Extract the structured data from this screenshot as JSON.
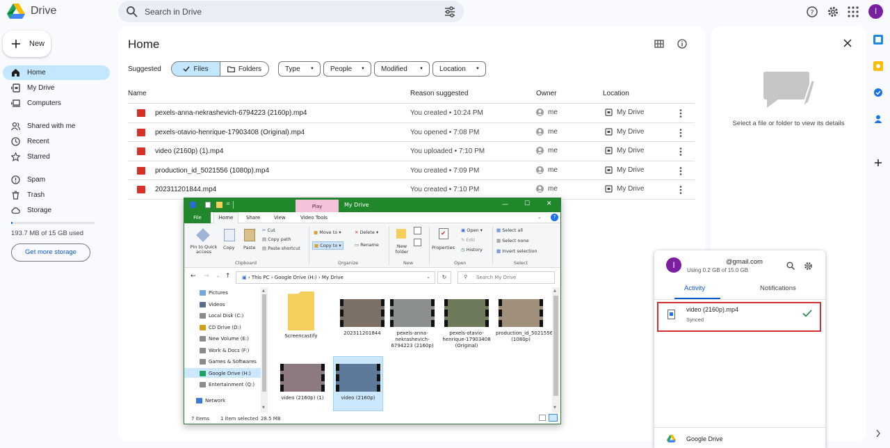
{
  "app": {
    "name": "Drive"
  },
  "search": {
    "placeholder": "Search in Drive"
  },
  "header": {
    "avatar_letter": "I"
  },
  "sidebar": {
    "new_label": "New",
    "items": [
      {
        "label": "Home"
      },
      {
        "label": "My Drive"
      },
      {
        "label": "Computers"
      },
      {
        "label": "Shared with me"
      },
      {
        "label": "Recent"
      },
      {
        "label": "Starred"
      },
      {
        "label": "Spam"
      },
      {
        "label": "Trash"
      },
      {
        "label": "Storage"
      }
    ],
    "storage_text": "193.7 MB of 15 GB used",
    "storage_fraction": 0.013,
    "get_storage_label": "Get more storage"
  },
  "main": {
    "title": "Home",
    "suggested_label": "Suggested",
    "files_chip": "Files",
    "folders_chip": "Folders",
    "filters": [
      "Type",
      "People",
      "Modified",
      "Location"
    ],
    "columns": {
      "name": "Name",
      "reason": "Reason suggested",
      "owner": "Owner",
      "location": "Location"
    },
    "rows": [
      {
        "name": "pexels-anna-nekrashevich-6794223 (2160p).mp4",
        "reason": "You created • 10:24 PM",
        "owner": "me",
        "location": "My Drive"
      },
      {
        "name": "pexels-otavio-henrique-17903408 (Original).mp4",
        "reason": "You opened • 7:08 PM",
        "owner": "me",
        "location": "My Drive"
      },
      {
        "name": "video (2160p) (1).mp4",
        "reason": "You uploaded • 7:10 PM",
        "owner": "me",
        "location": "My Drive"
      },
      {
        "name": "production_id_5021556 (1080p).mp4",
        "reason": "You created • 7:09 PM",
        "owner": "me",
        "location": "My Drive"
      },
      {
        "name": "202311201844.mp4",
        "reason": "You created • 7:10 PM",
        "owner": "me",
        "location": "My Drive"
      }
    ]
  },
  "details_panel": {
    "empty_text": "Select a file or folder to view its details"
  },
  "explorer": {
    "title": "My Drive",
    "play_tab": "Play",
    "video_tools_tab": "Video Tools",
    "tabs": [
      "File",
      "Home",
      "Share",
      "View"
    ],
    "ribbon": {
      "pin": "Pin to Quick access",
      "copy": "Copy",
      "paste": "Paste",
      "cut": "Cut",
      "copy_path": "Copy path",
      "paste_shortcut": "Paste shortcut",
      "move_to": "Move to",
      "copy_to": "Copy to",
      "delete": "Delete",
      "rename": "Rename",
      "new_folder": "New folder",
      "properties": "Properties",
      "open": "Open",
      "edit": "Edit",
      "history": "History",
      "select_all": "Select all",
      "select_none": "Select none",
      "invert": "Invert selection",
      "groups": [
        "Clipboard",
        "Organize",
        "New",
        "Open",
        "Select"
      ]
    },
    "address": [
      "This PC",
      "Google Drive (H:)",
      "My Drive"
    ],
    "search_placeholder": "Search My Drive",
    "nav": [
      "Pictures",
      "Videos",
      "Local Disk (C:)",
      "CD Drive (D:)",
      "New Volume (E:)",
      "Work & Docs (F:)",
      "Games & Softwares",
      "Google Drive (H:)",
      "Entertainment (Q:)",
      "Network"
    ],
    "files": [
      "Screencastify",
      "202311201844",
      "pexels-anna-nekrashevich-6794223 (2160p)",
      "pexels-otavio-henrique-17903408 (Original)",
      "production_id_5021556 (1080p)",
      "video (2160p) (1)",
      "video (2160p)"
    ],
    "status": {
      "items": "7 items",
      "selected": "1 item selected",
      "size": "28.5 MB"
    }
  },
  "sync_popup": {
    "avatar_letter": "I",
    "email": "@gmail.com",
    "usage": "Using 0.2 GB of 15.0 GB",
    "tab_activity": "Activity",
    "tab_notifications": "Notifications",
    "item_name": "video (2160p).mp4",
    "item_status": "Synced",
    "footer": "Google Drive"
  },
  "colors": {
    "accent": "#0b57d0",
    "selected": "#c2e7ff",
    "explorer_green": "#21872b",
    "video_red": "#d93025"
  }
}
